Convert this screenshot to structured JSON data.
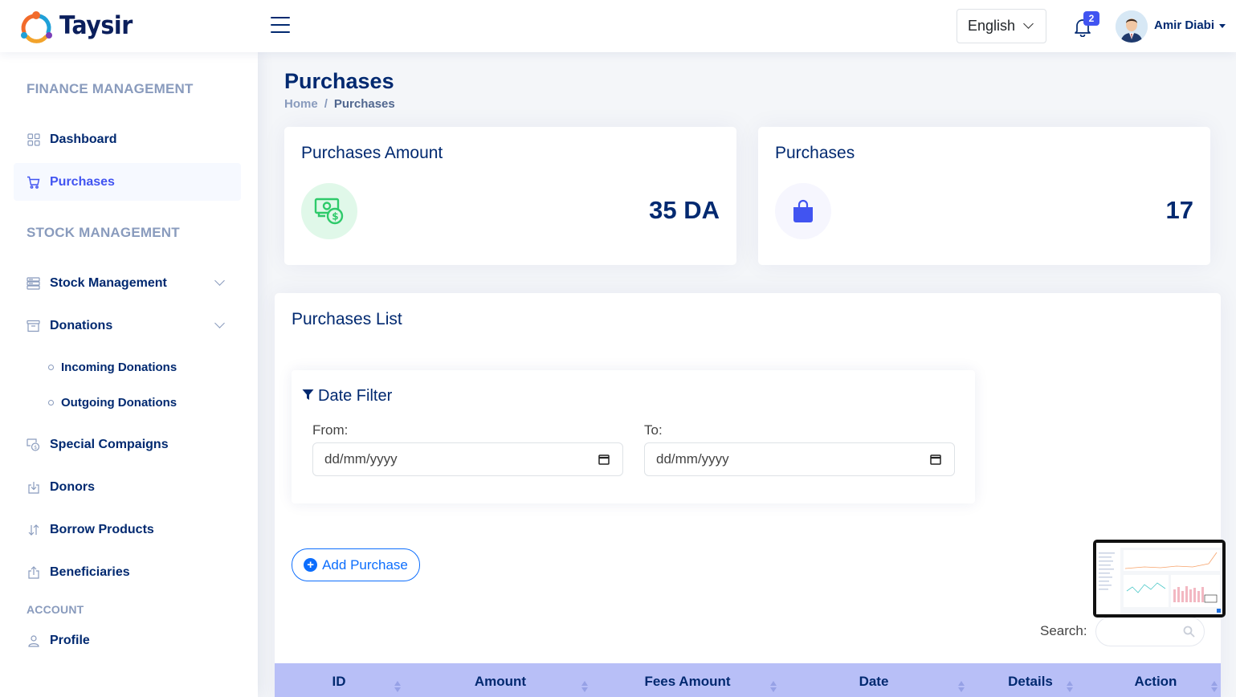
{
  "app": {
    "name": "Taysir"
  },
  "header": {
    "language": "English",
    "notifications_count": "2",
    "user_name": "Amir Diabi"
  },
  "sidebar": {
    "finance_heading": "FINANCE MANAGEMENT",
    "stock_heading": "STOCK MANAGEMENT",
    "account_heading": "ACCOUNT",
    "items": [
      {
        "label": "Dashboard",
        "icon": "grid-icon"
      },
      {
        "label": "Purchases",
        "icon": "cart-icon",
        "active": true
      },
      {
        "label": "Stock Management",
        "icon": "storage-icon",
        "expandable": true
      },
      {
        "label": "Donations",
        "icon": "archive-icon",
        "expandable": true
      },
      {
        "label": "Special Compaigns",
        "icon": "cash-coin-icon"
      },
      {
        "label": "Donors",
        "icon": "box-arrow-in-down-icon"
      },
      {
        "label": "Borrow Products",
        "icon": "arrow-down-up-icon"
      },
      {
        "label": "Beneficiaries",
        "icon": "box-arrow-up-icon"
      },
      {
        "label": "Profile",
        "icon": "person-icon"
      }
    ],
    "donations_sub": [
      "Incoming Donations",
      "Outgoing Donations"
    ]
  },
  "page": {
    "title": "Purchases",
    "breadcrumb": {
      "home": "Home",
      "separator": "/",
      "current": "Purchases"
    }
  },
  "stats": [
    {
      "title": "Purchases Amount",
      "value": "35 DA",
      "icon": "cash-icon",
      "color": "#2eca6a",
      "bg": "#e0f8e9"
    },
    {
      "title": "Purchases",
      "value": "17",
      "icon": "bag-icon",
      "color": "#4154f1",
      "bg": "#f6f6fe"
    }
  ],
  "list": {
    "title": "Purchases List",
    "filter": {
      "title": "Date Filter",
      "from_label": "From:",
      "to_label": "To:",
      "from_placeholder": "dd/mm/yyyy",
      "to_placeholder": "dd/mm/yyyy"
    },
    "add_button": "Add Purchase",
    "search_label": "Search:",
    "columns": [
      "ID",
      "Amount",
      "Fees Amount",
      "Date",
      "Details",
      "Action"
    ]
  },
  "colors": {
    "accent": "#4154f1",
    "primary_text": "#012970",
    "muted": "#899bbd",
    "table_header": "#b8bff7",
    "link_blue": "#0d6efd"
  }
}
